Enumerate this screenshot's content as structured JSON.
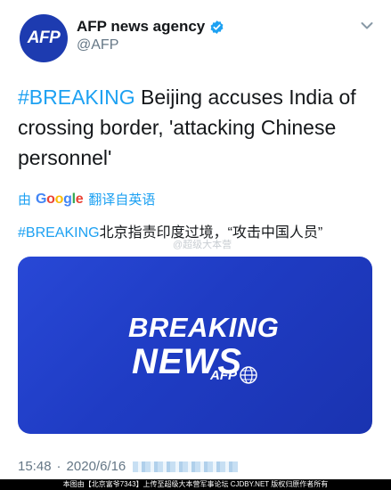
{
  "account": {
    "avatar_text": "AFP",
    "name": "AFP news agency",
    "handle": "@AFP",
    "verified_icon": "verified-badge-icon",
    "menu_icon": "chevron-down-icon"
  },
  "tweet": {
    "hashtag": "#BREAKING",
    "text": " Beijing accuses India of crossing border, 'attacking Chinese personnel'"
  },
  "translation": {
    "by_label": "由",
    "google_letters": [
      "G",
      "o",
      "o",
      "g",
      "l",
      "e"
    ],
    "translated_from": "翻译自英语",
    "hashtag": "#BREAKING",
    "text": "北京指责印度过境，“攻击中国人员”"
  },
  "card": {
    "line1": "BREAKING",
    "line2": "NEWS",
    "logo_text": "AFP"
  },
  "timestamp": {
    "time": "15:48",
    "separator": "·",
    "date": "2020/6/16"
  },
  "watermark": {
    "mid_text": "@超级大本营",
    "footer_text": "本图由【北京富爷7343】上传至超级大本营军事论坛 CJDBY.NET 版权归原作者所有"
  },
  "colors": {
    "accent": "#1da1f2",
    "card_bg": "#1f3cc4",
    "avatar_bg": "#1d3bb0",
    "text": "#14171a",
    "secondary": "#657786"
  }
}
